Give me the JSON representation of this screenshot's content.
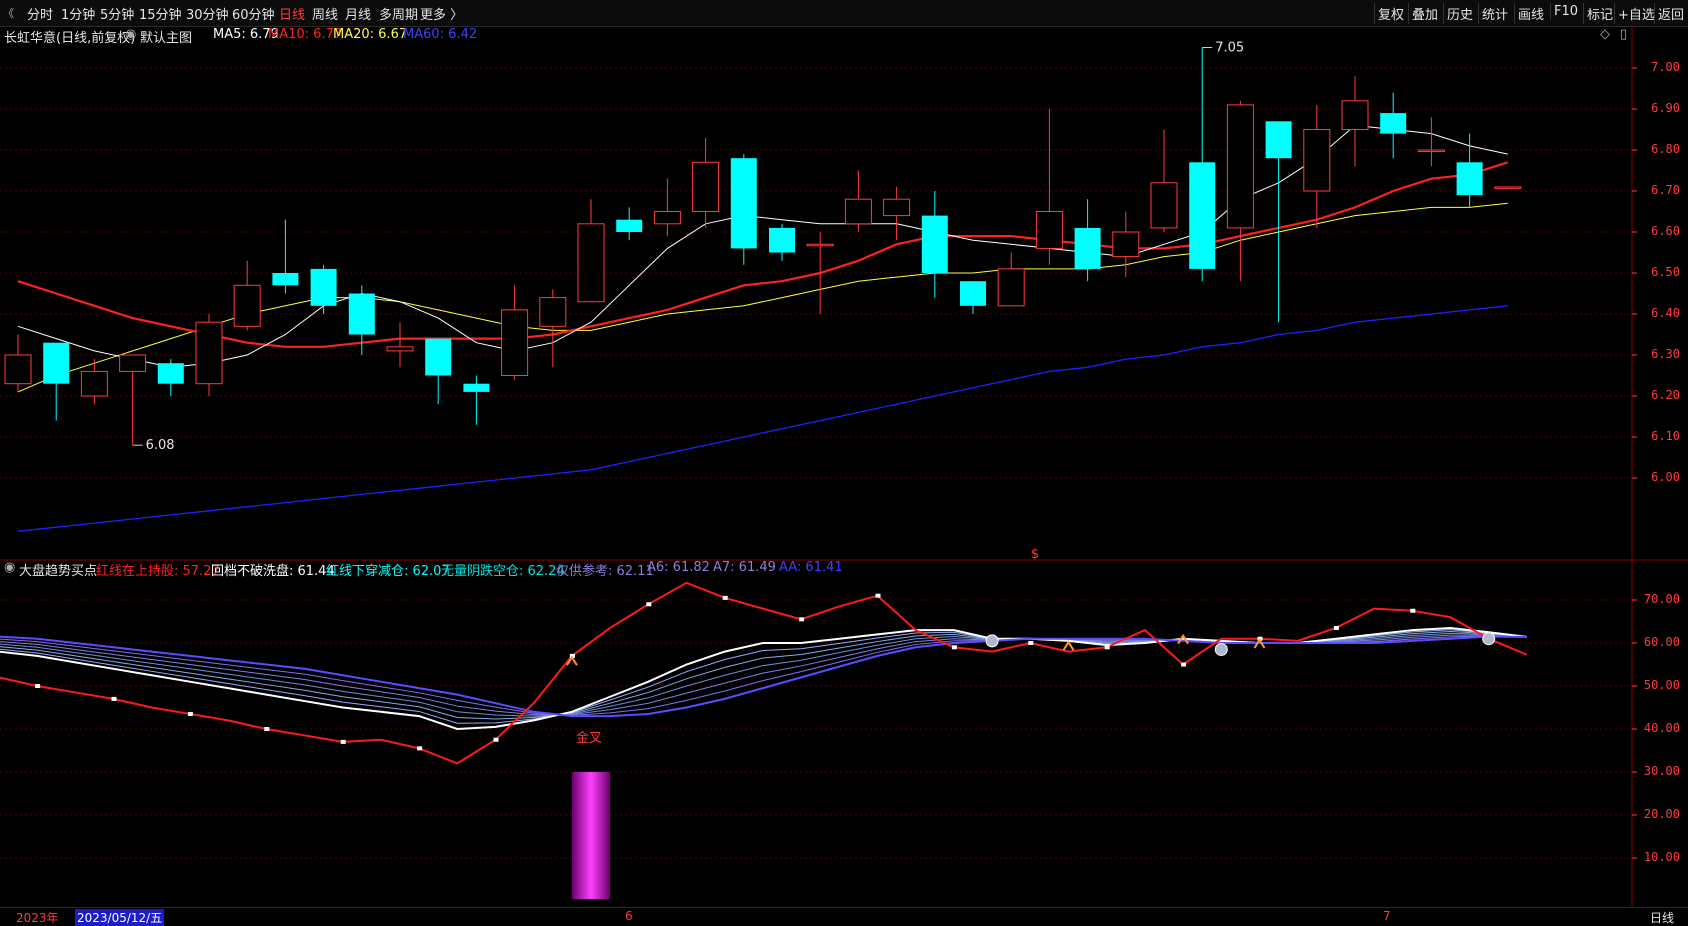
{
  "toolbar": {
    "back_glyph": "《",
    "periods": [
      "分时",
      "1分钟",
      "5分钟",
      "15分钟",
      "30分钟",
      "60分钟",
      "日线",
      "周线",
      "月线",
      "多周期",
      "更多 〉"
    ],
    "active_period": "日线",
    "right_buttons": [
      "复权",
      "叠加",
      "历史",
      "统计",
      "画线",
      "F10",
      "标记",
      "+自选",
      "返回"
    ]
  },
  "main_legend": {
    "stock": "长虹华意(日线,前复权)",
    "template": "默认主图",
    "ma5": "MA5: 6.79",
    "ma10": "MA10: 6.77",
    "ma20": "MA20: 6.67",
    "ma60": "MA60: 6.42"
  },
  "main_annotations": {
    "high": "7.05",
    "low": "6.08",
    "marker": "$"
  },
  "y_axis_main": [
    "7.00",
    "6.90",
    "6.80",
    "6.70",
    "6.60",
    "6.50",
    "6.40",
    "6.30",
    "6.20",
    "6.10",
    "6.00"
  ],
  "sub_legend": {
    "indicator": "大盘趋势买点",
    "red_line": "红线在上持股: 57.27",
    "pullback": "回档不破洗盘: 61.44",
    "cross_down": "红线下穿减仓: 62.07",
    "no_volume": "无量阴跌空仓: 62.24",
    "reference": "仅供参考: 62.11",
    "a6": "A6: 61.82",
    "a7": "A7: 61.49",
    "aa": "AA: 61.41"
  },
  "sub_annotation": "金叉",
  "y_axis_sub": [
    "70.00",
    "60.00",
    "50.00",
    "40.00",
    "30.00",
    "20.00",
    "10.00"
  ],
  "date_bar": {
    "year": "2023年",
    "cursor_date": "2023/05/12/五",
    "month6": "6",
    "month7": "7",
    "period": "日线"
  },
  "colors": {
    "up": "#ff3b3b",
    "down": "#00ffff",
    "ma5": "#ffffff",
    "ma10": "#ff2020",
    "ma20": "#ffff40",
    "ma60": "#2020ff",
    "bar": "#ee00ee"
  },
  "chart_data": {
    "type": "candlestick",
    "ylim": [
      5.88,
      7.12
    ],
    "candles": [
      [
        6.23,
        6.3,
        6.35,
        6.21
      ],
      [
        6.33,
        6.23,
        6.33,
        6.14
      ],
      [
        6.2,
        6.26,
        6.29,
        6.18
      ],
      [
        6.26,
        6.3,
        6.3,
        6.08
      ],
      [
        6.28,
        6.23,
        6.29,
        6.2
      ],
      [
        6.23,
        6.38,
        6.4,
        6.2
      ],
      [
        6.37,
        6.47,
        6.53,
        6.36
      ],
      [
        6.5,
        6.47,
        6.63,
        6.45
      ],
      [
        6.51,
        6.42,
        6.52,
        6.4
      ],
      [
        6.45,
        6.35,
        6.47,
        6.3
      ],
      [
        6.31,
        6.32,
        6.38,
        6.27
      ],
      [
        6.34,
        6.25,
        6.34,
        6.18
      ],
      [
        6.23,
        6.21,
        6.25,
        6.13
      ],
      [
        6.25,
        6.41,
        6.47,
        6.24
      ],
      [
        6.37,
        6.44,
        6.46,
        6.27
      ],
      [
        6.43,
        6.62,
        6.68,
        6.43
      ],
      [
        6.63,
        6.6,
        6.66,
        6.58
      ],
      [
        6.62,
        6.65,
        6.73,
        6.59
      ],
      [
        6.65,
        6.77,
        6.83,
        6.61
      ],
      [
        6.78,
        6.56,
        6.79,
        6.52
      ],
      [
        6.61,
        6.55,
        6.62,
        6.53
      ],
      [
        6.57,
        6.57,
        6.6,
        6.4
      ],
      [
        6.62,
        6.68,
        6.75,
        6.6
      ],
      [
        6.64,
        6.68,
        6.71,
        6.58
      ],
      [
        6.64,
        6.5,
        6.7,
        6.44
      ],
      [
        6.48,
        6.42,
        6.48,
        6.4
      ],
      [
        6.42,
        6.51,
        6.55,
        6.42
      ],
      [
        6.56,
        6.65,
        6.9,
        6.52
      ],
      [
        6.61,
        6.51,
        6.68,
        6.48
      ],
      [
        6.54,
        6.6,
        6.65,
        6.49
      ],
      [
        6.61,
        6.72,
        6.85,
        6.6
      ],
      [
        6.77,
        6.51,
        7.05,
        6.48
      ],
      [
        6.61,
        6.91,
        6.92,
        6.48
      ],
      [
        6.87,
        6.78,
        6.87,
        6.38
      ],
      [
        6.7,
        6.85,
        6.91,
        6.61
      ],
      [
        6.85,
        6.92,
        6.98,
        6.76
      ],
      [
        6.89,
        6.84,
        6.94,
        6.78
      ],
      [
        6.8,
        6.8,
        6.88,
        6.76
      ],
      [
        6.77,
        6.69,
        6.84,
        6.66
      ],
      [
        6.71,
        6.71,
        6.71,
        6.71
      ]
    ],
    "ma5": [
      6.37,
      6.34,
      6.31,
      6.29,
      6.27,
      6.28,
      6.3,
      6.35,
      6.42,
      6.45,
      6.43,
      6.39,
      6.33,
      6.31,
      6.33,
      6.38,
      6.47,
      6.56,
      6.62,
      6.64,
      6.63,
      6.62,
      6.62,
      6.62,
      6.6,
      6.58,
      6.57,
      6.56,
      6.55,
      6.54,
      6.57,
      6.6,
      6.68,
      6.72,
      6.78,
      6.86,
      6.85,
      6.84,
      6.81,
      6.79
    ],
    "ma10": [
      6.48,
      6.45,
      6.42,
      6.39,
      6.37,
      6.35,
      6.33,
      6.32,
      6.32,
      6.33,
      6.34,
      6.34,
      6.34,
      6.34,
      6.35,
      6.37,
      6.39,
      6.41,
      6.44,
      6.47,
      6.48,
      6.5,
      6.53,
      6.57,
      6.59,
      6.59,
      6.59,
      6.58,
      6.57,
      6.56,
      6.56,
      6.57,
      6.59,
      6.61,
      6.63,
      6.66,
      6.7,
      6.73,
      6.74,
      6.77
    ],
    "ma20": [
      6.21,
      6.25,
      6.28,
      6.31,
      6.34,
      6.37,
      6.4,
      6.42,
      6.44,
      6.44,
      6.43,
      6.41,
      6.39,
      6.37,
      6.36,
      6.36,
      6.38,
      6.4,
      6.41,
      6.42,
      6.44,
      6.46,
      6.48,
      6.49,
      6.5,
      6.5,
      6.51,
      6.51,
      6.51,
      6.52,
      6.54,
      6.55,
      6.58,
      6.6,
      6.62,
      6.64,
      6.65,
      6.66,
      6.66,
      6.67
    ],
    "ma60": [
      5.87,
      5.88,
      5.89,
      5.9,
      5.91,
      5.92,
      5.93,
      5.94,
      5.95,
      5.96,
      5.97,
      5.98,
      5.99,
      6.0,
      6.01,
      6.02,
      6.04,
      6.06,
      6.08,
      6.1,
      6.12,
      6.14,
      6.16,
      6.18,
      6.2,
      6.22,
      6.24,
      6.26,
      6.27,
      6.29,
      6.3,
      6.32,
      6.33,
      6.35,
      6.36,
      6.38,
      6.39,
      6.4,
      6.41,
      6.42
    ],
    "sub": {
      "ylim": [
        0,
        78
      ],
      "red": [
        52,
        50,
        48.5,
        47,
        45,
        43.5,
        42,
        40,
        38.5,
        37,
        37.5,
        35.5,
        32,
        37.5,
        46,
        57,
        63.5,
        69,
        74,
        70.5,
        68,
        65.5,
        68.5,
        71,
        63,
        59,
        58,
        60,
        58,
        59,
        63,
        55,
        61,
        61,
        60.5,
        63.5,
        68,
        67.5,
        66,
        61,
        57.27
      ],
      "white": [
        58,
        57,
        55.5,
        54,
        52.5,
        51,
        49.5,
        48,
        46.5,
        45,
        44,
        43,
        40,
        40.5,
        42,
        44,
        47.5,
        51,
        55,
        58,
        60,
        60,
        61,
        62,
        63,
        63,
        61,
        61,
        60.5,
        59.5,
        60,
        61,
        60.5,
        60,
        60,
        61,
        62,
        63,
        63.5,
        62.5,
        61.44
      ],
      "purple": [
        61.5,
        61,
        60,
        59,
        58,
        57,
        56,
        55,
        54,
        52.5,
        51,
        49.5,
        48,
        46,
        44,
        43,
        43,
        43.5,
        45,
        47,
        49.5,
        52,
        54.5,
        57,
        59,
        60,
        60.5,
        61,
        61,
        61,
        61,
        60.5,
        60,
        60,
        60,
        60,
        60,
        60.5,
        61,
        61.5,
        61.41
      ],
      "golden_cross_index": 15,
      "bar": {
        "index": 15,
        "value": 30
      }
    }
  }
}
